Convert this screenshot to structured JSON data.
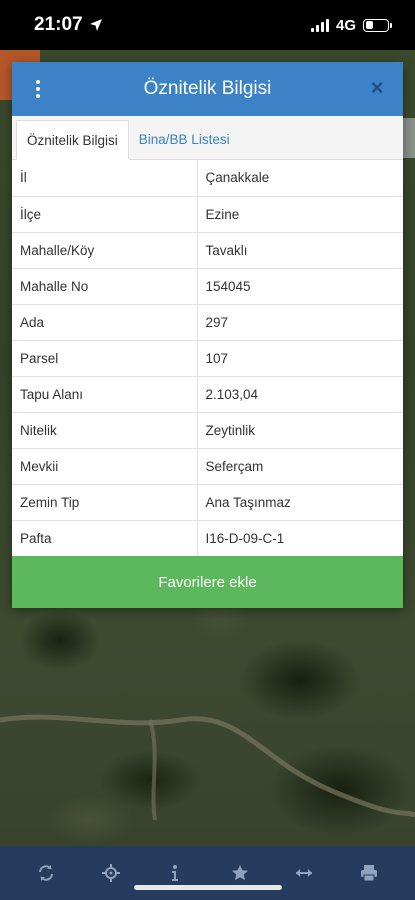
{
  "status_bar": {
    "time": "21:07",
    "network": "4G"
  },
  "modal": {
    "title": "Öznitelik Bilgisi",
    "close_label": "×",
    "tabs": [
      {
        "label": "Öznitelik Bilgisi",
        "active": true
      },
      {
        "label": "Bina/BB Listesi",
        "active": false
      }
    ],
    "rows": [
      {
        "key": "İl",
        "value": "Çanakkale"
      },
      {
        "key": "İlçe",
        "value": "Ezine"
      },
      {
        "key": "Mahalle/Köy",
        "value": "Tavaklı"
      },
      {
        "key": "Mahalle No",
        "value": "154045"
      },
      {
        "key": "Ada",
        "value": "297"
      },
      {
        "key": "Parsel",
        "value": "107"
      },
      {
        "key": "Tapu Alanı",
        "value": "2.103,04"
      },
      {
        "key": "Nitelik",
        "value": "Zeytinlik"
      },
      {
        "key": "Mevkii",
        "value": "Seferçam"
      },
      {
        "key": "Zemin Tip",
        "value": "Ana Taşınmaz"
      },
      {
        "key": "Pafta",
        "value": "I16-D-09-C-1"
      }
    ],
    "favorite_button": "Favorilere ekle"
  },
  "toolbar": {
    "items": [
      "refresh-icon",
      "locate-icon",
      "info-icon",
      "star-icon",
      "measure-icon",
      "print-icon"
    ]
  },
  "colors": {
    "header": "#3b82c7",
    "favorite_button": "#5cb85c",
    "toolbar": "#263c5f"
  }
}
